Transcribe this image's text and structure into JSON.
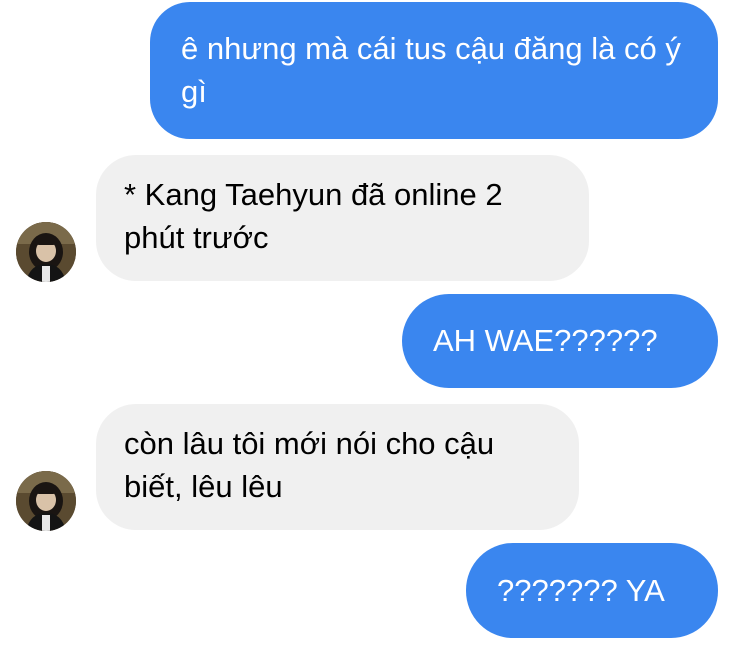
{
  "conversation": {
    "messages": [
      {
        "sender": "me",
        "text": "ê nhưng mà cái tus cậu đăng là có ý gì"
      },
      {
        "sender": "contact",
        "text": "* Kang Taehyun đã online 2 phút trước",
        "avatar": "contact-avatar-icon"
      },
      {
        "sender": "me",
        "text": "AH WAE??????"
      },
      {
        "sender": "contact",
        "text": "còn lâu tôi mới nói cho cậu biết, lêu lêu",
        "avatar": "contact-avatar-icon"
      },
      {
        "sender": "me",
        "text": "??????? YA"
      }
    ]
  },
  "colors": {
    "outgoing_bubble": "#3a86ef",
    "incoming_bubble": "#f0f0f0",
    "outgoing_text": "#ffffff",
    "incoming_text": "#000000"
  }
}
